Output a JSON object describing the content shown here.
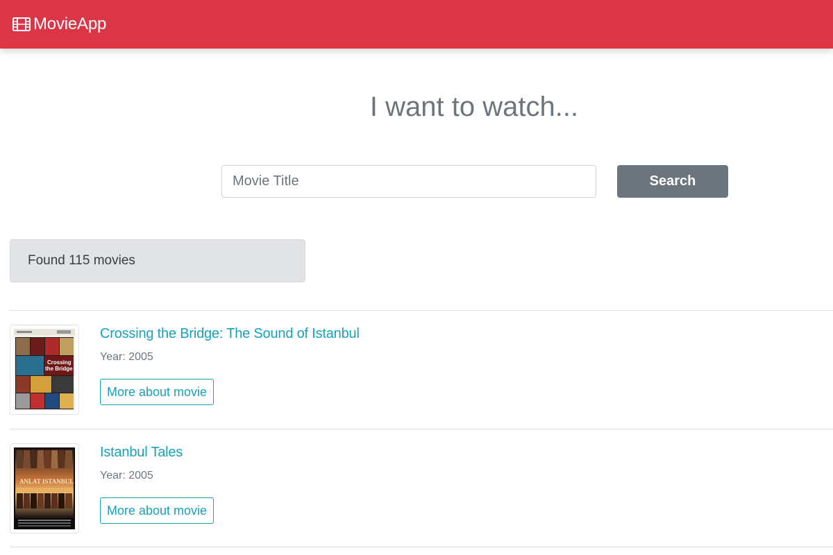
{
  "navbar": {
    "brand_icon": "film-icon",
    "brand_label": "MovieApp",
    "color": "#dc3545"
  },
  "hero": {
    "heading": "I want to watch..."
  },
  "search": {
    "placeholder": "Movie Title",
    "value": "",
    "button_label": "Search"
  },
  "results": {
    "count_text": "Found 115 movies",
    "movies": [
      {
        "title": "Crossing the Bridge: The Sound of Istanbul",
        "year_text": "Year: 2005",
        "button_label": "More about movie",
        "poster_icon": "movie-poster-image"
      },
      {
        "title": "Istanbul Tales",
        "year_text": "Year: 2005",
        "button_label": "More about movie",
        "poster_icon": "movie-poster-image"
      }
    ]
  },
  "colors": {
    "accent": "#17a2b8",
    "secondary": "#6c757d",
    "result_bg": "#e2e3e5"
  }
}
